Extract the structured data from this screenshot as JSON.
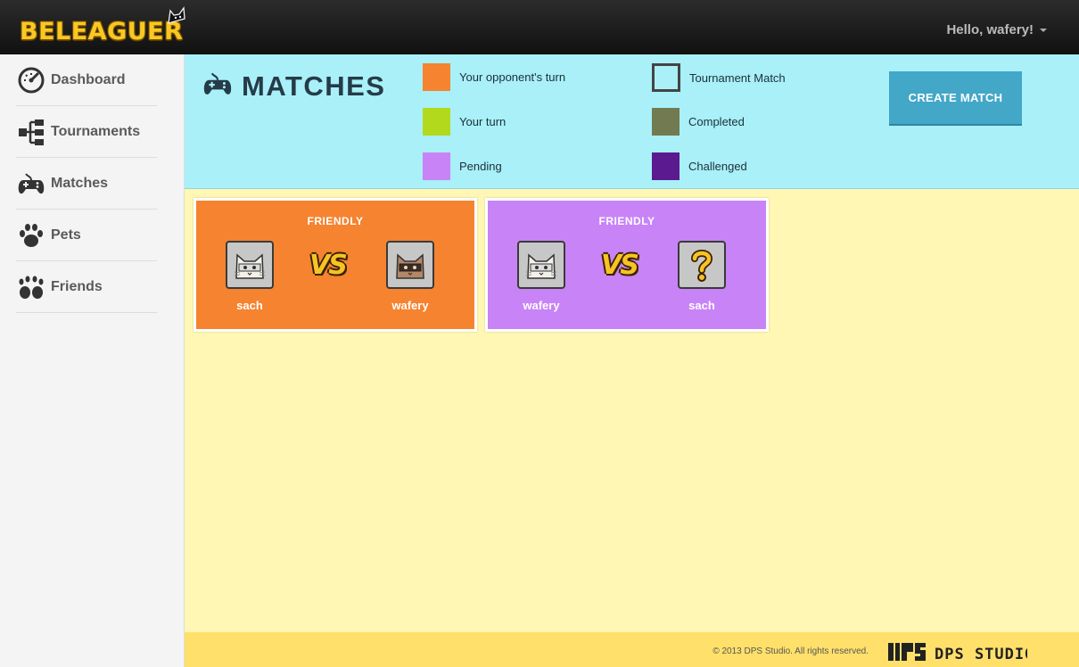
{
  "app": {
    "logo": "BELEAGUER",
    "greeting": "Hello, wafery!"
  },
  "sidebar": {
    "items": [
      {
        "label": "Dashboard",
        "icon": "speedometer-icon"
      },
      {
        "label": "Tournaments",
        "icon": "bracket-icon"
      },
      {
        "label": "Matches",
        "icon": "gamepad-icon"
      },
      {
        "label": "Pets",
        "icon": "paw-icon"
      },
      {
        "label": "Friends",
        "icon": "paws-icon"
      }
    ]
  },
  "header": {
    "title": "MATCHES",
    "create_button": "CREATE MATCH",
    "legend": [
      {
        "label": "Your opponent's turn",
        "color": "#f58330"
      },
      {
        "label": "Your turn",
        "color": "#b2d91b"
      },
      {
        "label": "Pending",
        "color": "#c883f7"
      },
      {
        "label": "Tournament Match",
        "color": "outline"
      },
      {
        "label": "Completed",
        "color": "#727a52"
      },
      {
        "label": "Challenged",
        "color": "#5b1a8f"
      }
    ]
  },
  "matches": [
    {
      "type": "FRIENDLY",
      "status_color": "#f58330",
      "vs": "VS",
      "player1": {
        "name": "sach",
        "avatar": "white-cat-icon"
      },
      "player2": {
        "name": "wafery",
        "avatar": "brown-cat-icon"
      }
    },
    {
      "type": "FRIENDLY",
      "status_color": "#c883f7",
      "vs": "VS",
      "player1": {
        "name": "wafery",
        "avatar": "white-cat-icon"
      },
      "player2": {
        "name": "sach",
        "avatar": "question-mark-icon"
      }
    }
  ],
  "footer": {
    "copyright": "© 2013 DPS Studio. All rights reserved.",
    "studio_logo": "DPS STUDIO"
  }
}
